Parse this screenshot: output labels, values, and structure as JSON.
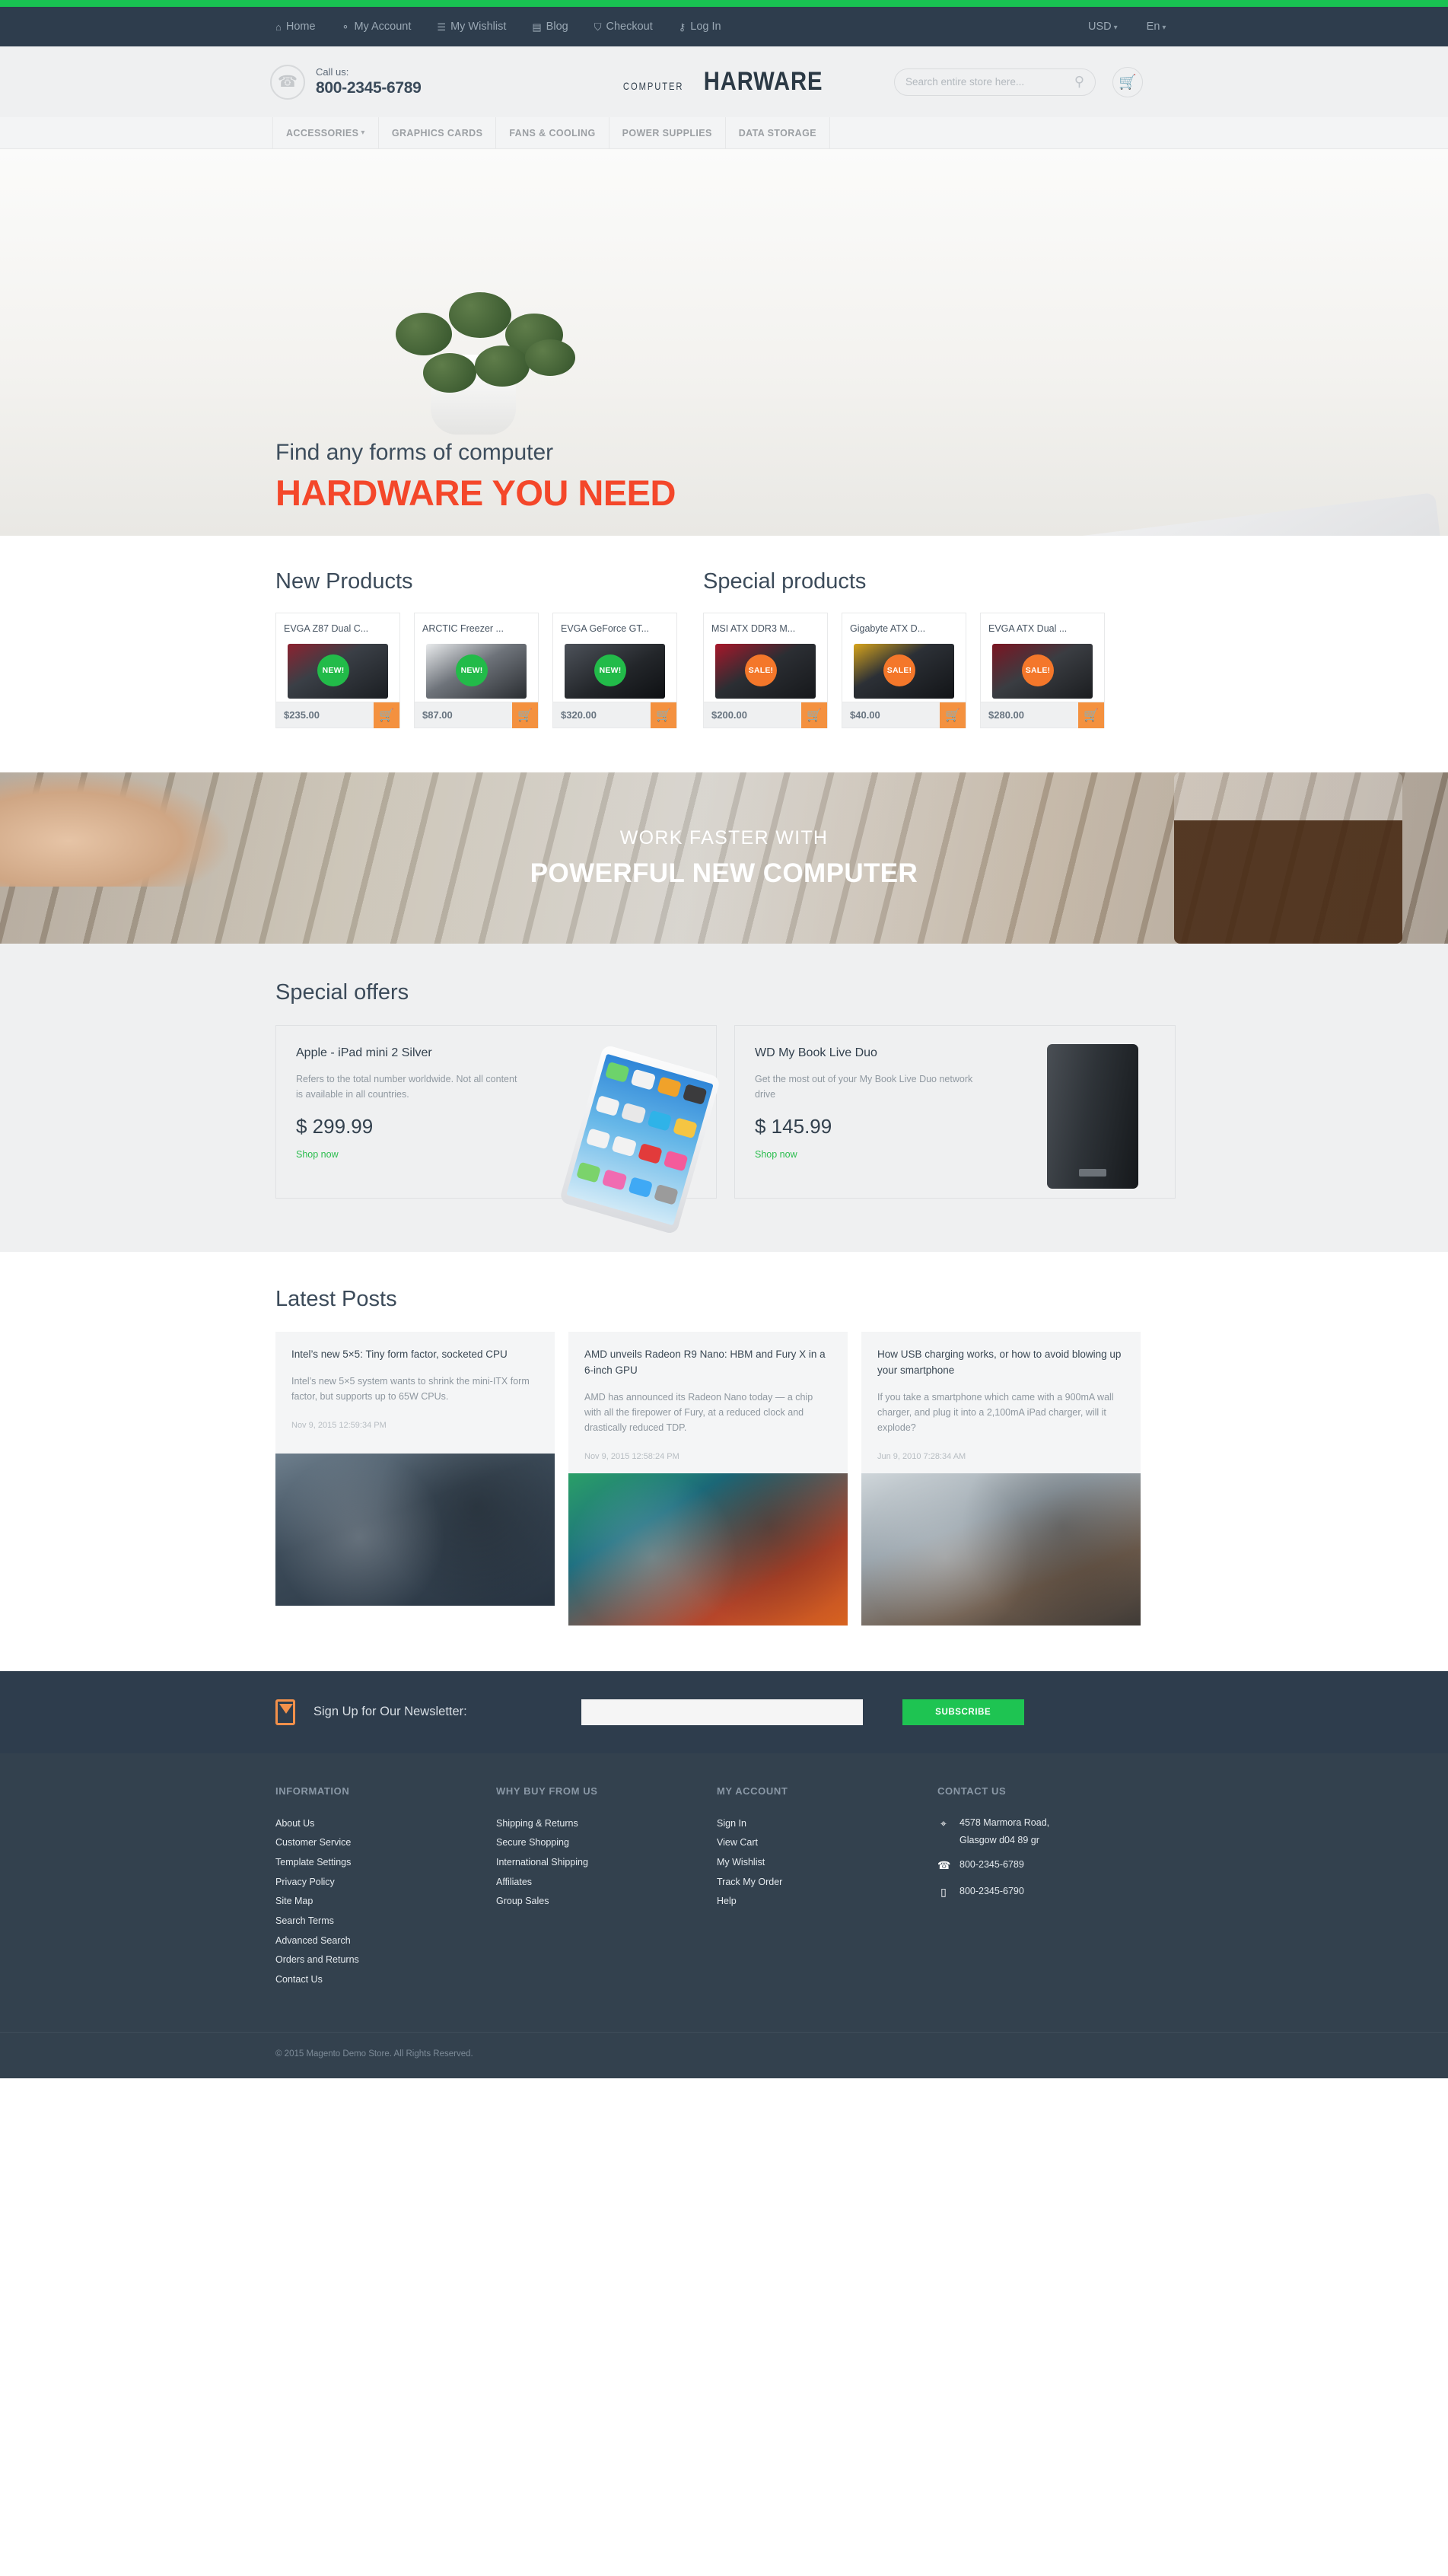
{
  "topbar": {
    "links": [
      {
        "label": "Home",
        "icon": "home-icon",
        "glyph": "⌂"
      },
      {
        "label": "My Account",
        "icon": "user-icon",
        "glyph": "⚬"
      },
      {
        "label": "My Wishlist",
        "icon": "list-icon",
        "glyph": "☰"
      },
      {
        "label": "Blog",
        "icon": "blog-icon",
        "glyph": "▤"
      },
      {
        "label": "Checkout",
        "icon": "cart-icon",
        "glyph": "⛉"
      },
      {
        "label": "Log In",
        "icon": "key-icon",
        "glyph": "⚷"
      }
    ],
    "currency": "USD",
    "language": "En"
  },
  "header": {
    "call_label": "Call us:",
    "phone": "800-2345-6789",
    "logo_top": "COMPUTER",
    "logo_main": "HARWARE",
    "search_placeholder": "Search entire store here...",
    "search_value": ""
  },
  "mainnav": {
    "items": [
      {
        "label": "ACCESSORIES",
        "has_dropdown": true
      },
      {
        "label": "GRAPHICS CARDS",
        "has_dropdown": false
      },
      {
        "label": "FANS & COOLING",
        "has_dropdown": false
      },
      {
        "label": "POWER SUPPLIES",
        "has_dropdown": false
      },
      {
        "label": "DATA STORAGE",
        "has_dropdown": false
      }
    ]
  },
  "hero": {
    "subtitle": "Find any forms of computer",
    "title": "HARDWARE YOU NEED",
    "accent_color": "#f4472a"
  },
  "new_products": {
    "title": "New Products",
    "items": [
      {
        "name": "EVGA Z87 Dual C...",
        "price": "$235.00",
        "badge": "NEW!",
        "badge_type": "new"
      },
      {
        "name": "ARCTIC Freezer ...",
        "price": "$87.00",
        "badge": "NEW!",
        "badge_type": "new"
      },
      {
        "name": "EVGA GeForce GT...",
        "price": "$320.00",
        "badge": "NEW!",
        "badge_type": "new"
      }
    ]
  },
  "special_products": {
    "title": "Special products",
    "items": [
      {
        "name": "MSI ATX DDR3 M...",
        "price": "$200.00",
        "badge": "SALE!",
        "badge_type": "sale"
      },
      {
        "name": "Gigabyte ATX D...",
        "price": "$40.00",
        "badge": "SALE!",
        "badge_type": "sale"
      },
      {
        "name": "EVGA ATX Dual ...",
        "price": "$280.00",
        "badge": "SALE!",
        "badge_type": "sale"
      }
    ]
  },
  "midbanner": {
    "line1": "WORK FASTER WITH",
    "line2": "POWERFUL NEW COMPUTER"
  },
  "offers": {
    "title": "Special offers",
    "items": [
      {
        "name": "Apple - iPad mini 2 Silver",
        "desc": "Refers to the total number worldwide. Not all content is available in all countries.",
        "price": "$ 299.99",
        "link": "Shop now"
      },
      {
        "name": "WD My Book Live Duo",
        "desc": "Get the most out of your My Book Live Duo network drive",
        "price": "$ 145.99",
        "link": "Shop now"
      }
    ]
  },
  "posts": {
    "title": "Latest Posts",
    "items": [
      {
        "title": "Intel’s new 5×5: Tiny form factor, socketed CPU",
        "excerpt": "Intel’s new 5×5 system wants to shrink the mini-ITX form factor, but supports up to 65W CPUs.",
        "date": "Nov 9, 2015 12:59:34 PM"
      },
      {
        "title": "AMD unveils Radeon R9 Nano: HBM and Fury X in a 6-inch GPU",
        "excerpt": "AMD has announced its Radeon Nano today — a chip with all the firepower of Fury, at a reduced clock and drastically reduced TDP.",
        "date": "Nov 9, 2015 12:58:24 PM"
      },
      {
        "title": "How USB charging works, or how to avoid blowing up your smartphone",
        "excerpt": "If you take a smartphone which came with a 900mA wall charger, and plug it into a 2,100mA iPad charger, will it explode?",
        "date": "Jun 9, 2010 7:28:34 AM"
      }
    ]
  },
  "newsletter": {
    "label": "Sign Up for Our Newsletter:",
    "input_value": "",
    "input_placeholder": "",
    "button": "SUBSCRIBE",
    "icon": "envelope-icon"
  },
  "footer": {
    "columns": [
      {
        "head": "INFORMATION",
        "links": [
          "About Us",
          "Customer Service",
          "Template Settings",
          "Privacy Policy",
          "Site Map",
          "Search Terms",
          "Advanced Search",
          "Orders and Returns",
          "Contact Us"
        ]
      },
      {
        "head": "WHY BUY FROM US",
        "links": [
          "Shipping & Returns",
          "Secure Shopping",
          "International Shipping",
          "Affiliates",
          "Group Sales"
        ]
      },
      {
        "head": "MY ACCOUNT",
        "links": [
          "Sign In",
          "View Cart",
          "My Wishlist",
          "Track My Order",
          "Help"
        ]
      }
    ],
    "contact": {
      "head": "CONTACT US",
      "address_line1": "4578 Marmora Road,",
      "address_line2": "Glasgow d04 89 gr",
      "phone": "800-2345-6789",
      "mobile": "800-2345-6790"
    },
    "copyright": "© 2015 Magento Demo Store. All Rights Reserved."
  }
}
